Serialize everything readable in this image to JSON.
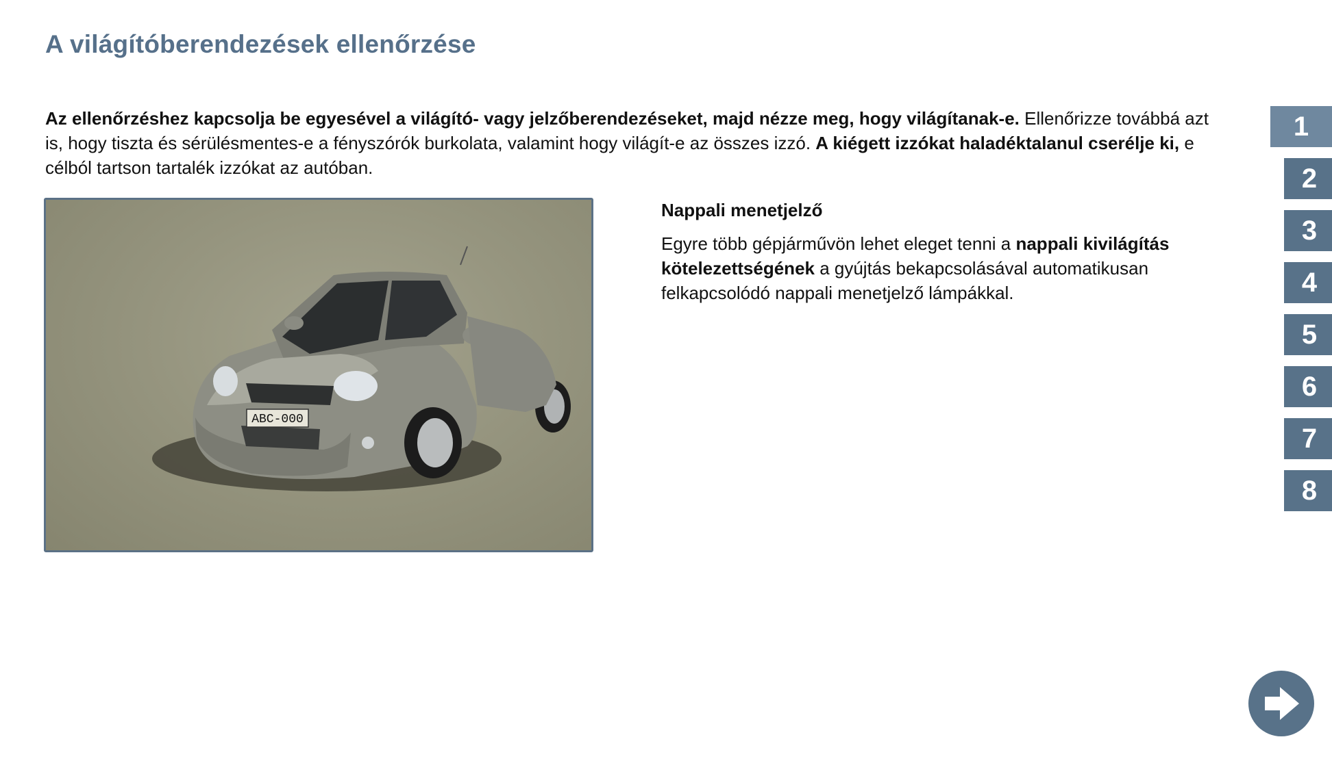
{
  "page": {
    "title": "A világítóberendezések ellenőrzése"
  },
  "intro": {
    "bold_1": "Az ellenőrzéshez kapcsolja be egyesével a világító- vagy jelzőberendezéseket, majd nézze meg, hogy világítanak-e.",
    "text_1": " Ellenőrizze továbbá azt is, hogy tiszta és sérülésmentes-e a fényszórók burkolata, valamint hogy világít-e az összes izzó. ",
    "bold_2": "A kiégett izzókat haladéktalanul cserélje ki,",
    "text_2": " e célból tartson tartalék izzókat az autóban."
  },
  "image": {
    "license_plate": "ABC-000"
  },
  "side": {
    "title": "Nappali menetjelző",
    "text_1": "Egyre több gépjárművön lehet eleget tenni a ",
    "bold_1": "nappali kivilágítás kötelezettségének",
    "text_2": " a gyújtás bekapcsolásával automatikusan felkapcsolódó nappali menetjelző lámpákkal."
  },
  "nav": {
    "active_page": "1",
    "pages": [
      "1",
      "2",
      "3",
      "4",
      "5",
      "6",
      "7",
      "8"
    ]
  },
  "next": {
    "icon": "arrow-right-icon"
  },
  "colors": {
    "accent": "#587289",
    "title": "#56708a",
    "active_tab": "#6f889f"
  }
}
